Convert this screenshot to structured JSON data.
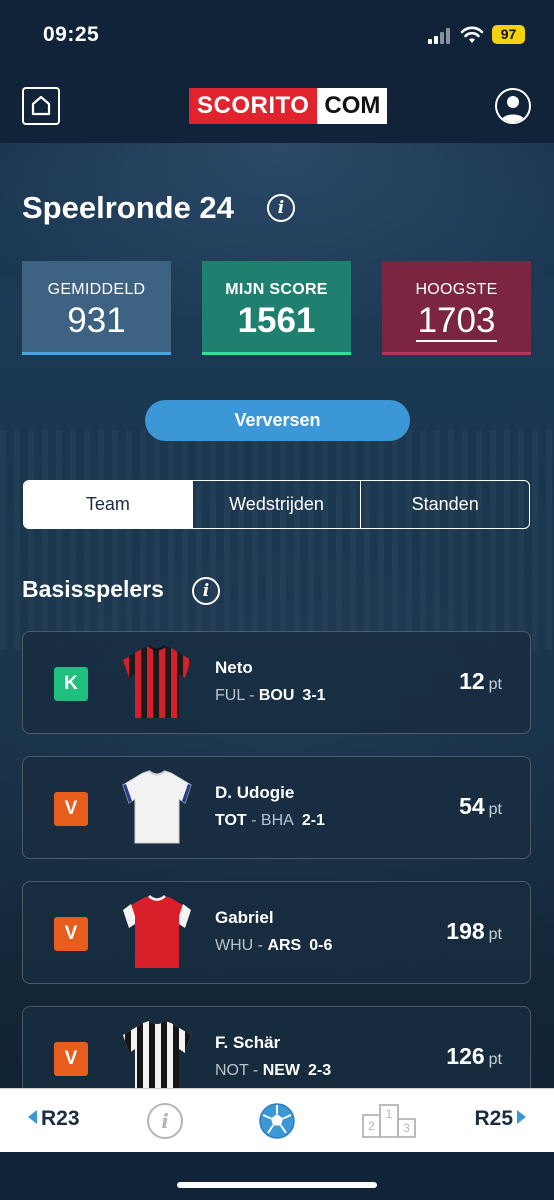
{
  "status": {
    "time": "09:25",
    "battery": "97"
  },
  "header": {
    "logo_left": "SCORITO",
    "logo_right": "COM"
  },
  "round": {
    "title": "Speelronde 24"
  },
  "scores": {
    "average": {
      "label": "GEMIDDELD",
      "value": "931"
    },
    "mine": {
      "label": "MIJN SCORE",
      "value": "1561"
    },
    "highest": {
      "label": "HOOGSTE",
      "value": "1703"
    }
  },
  "refresh_label": "Verversen",
  "tabs": [
    {
      "label": "Team",
      "active": true
    },
    {
      "label": "Wedstrijden",
      "active": false
    },
    {
      "label": "Standen",
      "active": false
    }
  ],
  "section_title": "Basisspelers",
  "players": [
    {
      "badge": "K",
      "name": "Neto",
      "home": "FUL",
      "away": "BOU",
      "highlight": "away",
      "score": "3-1",
      "points": "12",
      "unit": "pt",
      "shirt": "red-black-stripes"
    },
    {
      "badge": "V",
      "name": "D. Udogie",
      "home": "TOT",
      "away": "BHA",
      "highlight": "home",
      "score": "2-1",
      "points": "54",
      "unit": "pt",
      "shirt": "white"
    },
    {
      "badge": "V",
      "name": "Gabriel",
      "home": "WHU",
      "away": "ARS",
      "highlight": "away",
      "score": "0-6",
      "points": "198",
      "unit": "pt",
      "shirt": "red-white-sleeves"
    },
    {
      "badge": "V",
      "name": "F. Schär",
      "home": "NOT",
      "away": "NEW",
      "highlight": "away",
      "score": "2-3",
      "points": "126",
      "unit": "pt",
      "shirt": "black-white-stripes"
    }
  ],
  "bottom_nav": {
    "prev": "R23",
    "next": "R25",
    "podium": [
      "1",
      "2",
      "3"
    ]
  },
  "colors": {
    "accent_blue": "#3b97d6",
    "average_tile": "#3e6281",
    "mine_tile": "#20806f",
    "highest_tile": "#7c2540",
    "captain_badge": "#1fbf7d",
    "vice_badge": "#e85d1c",
    "logo_red": "#e0232c"
  },
  "icons": [
    "home-icon",
    "user-icon",
    "info-icon",
    "soccer-ball-icon",
    "podium-icon",
    "arrow-left-icon",
    "arrow-right-icon",
    "wifi-icon",
    "signal-icon"
  ]
}
